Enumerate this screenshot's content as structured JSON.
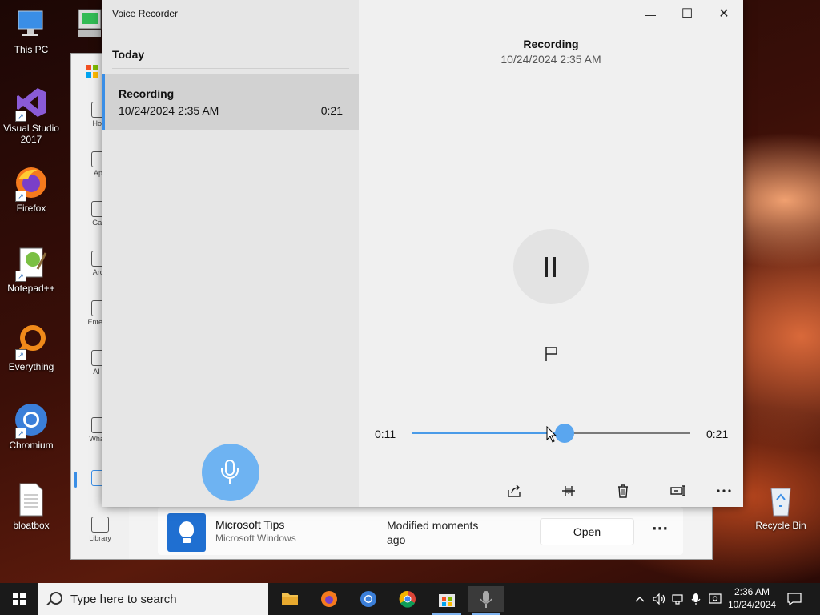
{
  "desktop": {
    "icons": [
      {
        "label": "This PC"
      },
      {
        "label": "Visual Studio 2017"
      },
      {
        "label": "Firefox"
      },
      {
        "label": "Notepad++"
      },
      {
        "label": "Everything"
      },
      {
        "label": "Chromium"
      },
      {
        "label": "bloatbox"
      },
      {
        "label": "Recycle Bin"
      }
    ]
  },
  "store": {
    "rail": [
      "Hom",
      "App",
      "Gam",
      "Arca",
      "Entertai",
      "AI H",
      "What's",
      "",
      "Library"
    ],
    "row": {
      "name": "Microsoft Tips",
      "publisher": "Microsoft Windows",
      "modified": "Modified moments ago",
      "open_label": "Open",
      "more_label": "···"
    }
  },
  "recorder": {
    "title": "Voice Recorder",
    "list_header": "Today",
    "items": [
      {
        "name": "Recording",
        "date": "10/24/2024 2:35 AM",
        "duration": "0:21"
      }
    ],
    "current": {
      "name": "Recording",
      "date": "10/24/2024 2:35 AM",
      "elapsed": "0:11",
      "total": "0:21",
      "progress": 0.55
    },
    "window_controls": {
      "minimize": "—",
      "maximize": "☐",
      "close": "✕"
    },
    "toolbar": [
      "share-icon",
      "trim-icon",
      "delete-icon",
      "rename-icon",
      "more-icon"
    ],
    "accent": "#6eb3f2"
  },
  "taskbar": {
    "search_placeholder": "Type here to search",
    "time": "2:36 AM",
    "date": "10/24/2024"
  }
}
